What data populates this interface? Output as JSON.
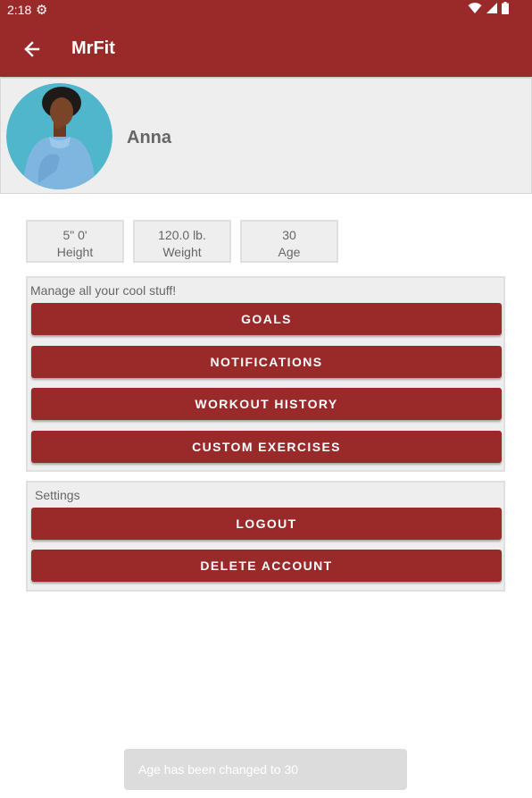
{
  "status_bar": {
    "time": "2:18",
    "icons": [
      "settings-gear-icon",
      "wifi-icon",
      "cell-signal-icon",
      "battery-icon"
    ]
  },
  "app_bar": {
    "title": "MrFit",
    "back_icon": "arrow-back-icon",
    "color": "#9a2a2a"
  },
  "profile": {
    "name": "Anna",
    "avatar_icon": "avatar-photo"
  },
  "stats": [
    {
      "value": "5\" 0'",
      "label": "Height"
    },
    {
      "value": "120.0 lb.",
      "label": "Weight"
    },
    {
      "value": "30",
      "label": "Age"
    }
  ],
  "manage_panel": {
    "caption": "Manage all your cool stuff!",
    "buttons": [
      "GOALS",
      "NOTIFICATIONS",
      "WORKOUT HISTORY",
      "CUSTOM EXERCISES"
    ]
  },
  "settings_panel": {
    "caption": "Settings",
    "buttons": [
      "LOGOUT",
      "DELETE ACCOUNT"
    ]
  },
  "toast": {
    "message": "Age has been changed to 30"
  },
  "colors": {
    "primary": "#9a2a2a",
    "panel_bg": "#eeeeee",
    "text_muted": "#666666"
  }
}
